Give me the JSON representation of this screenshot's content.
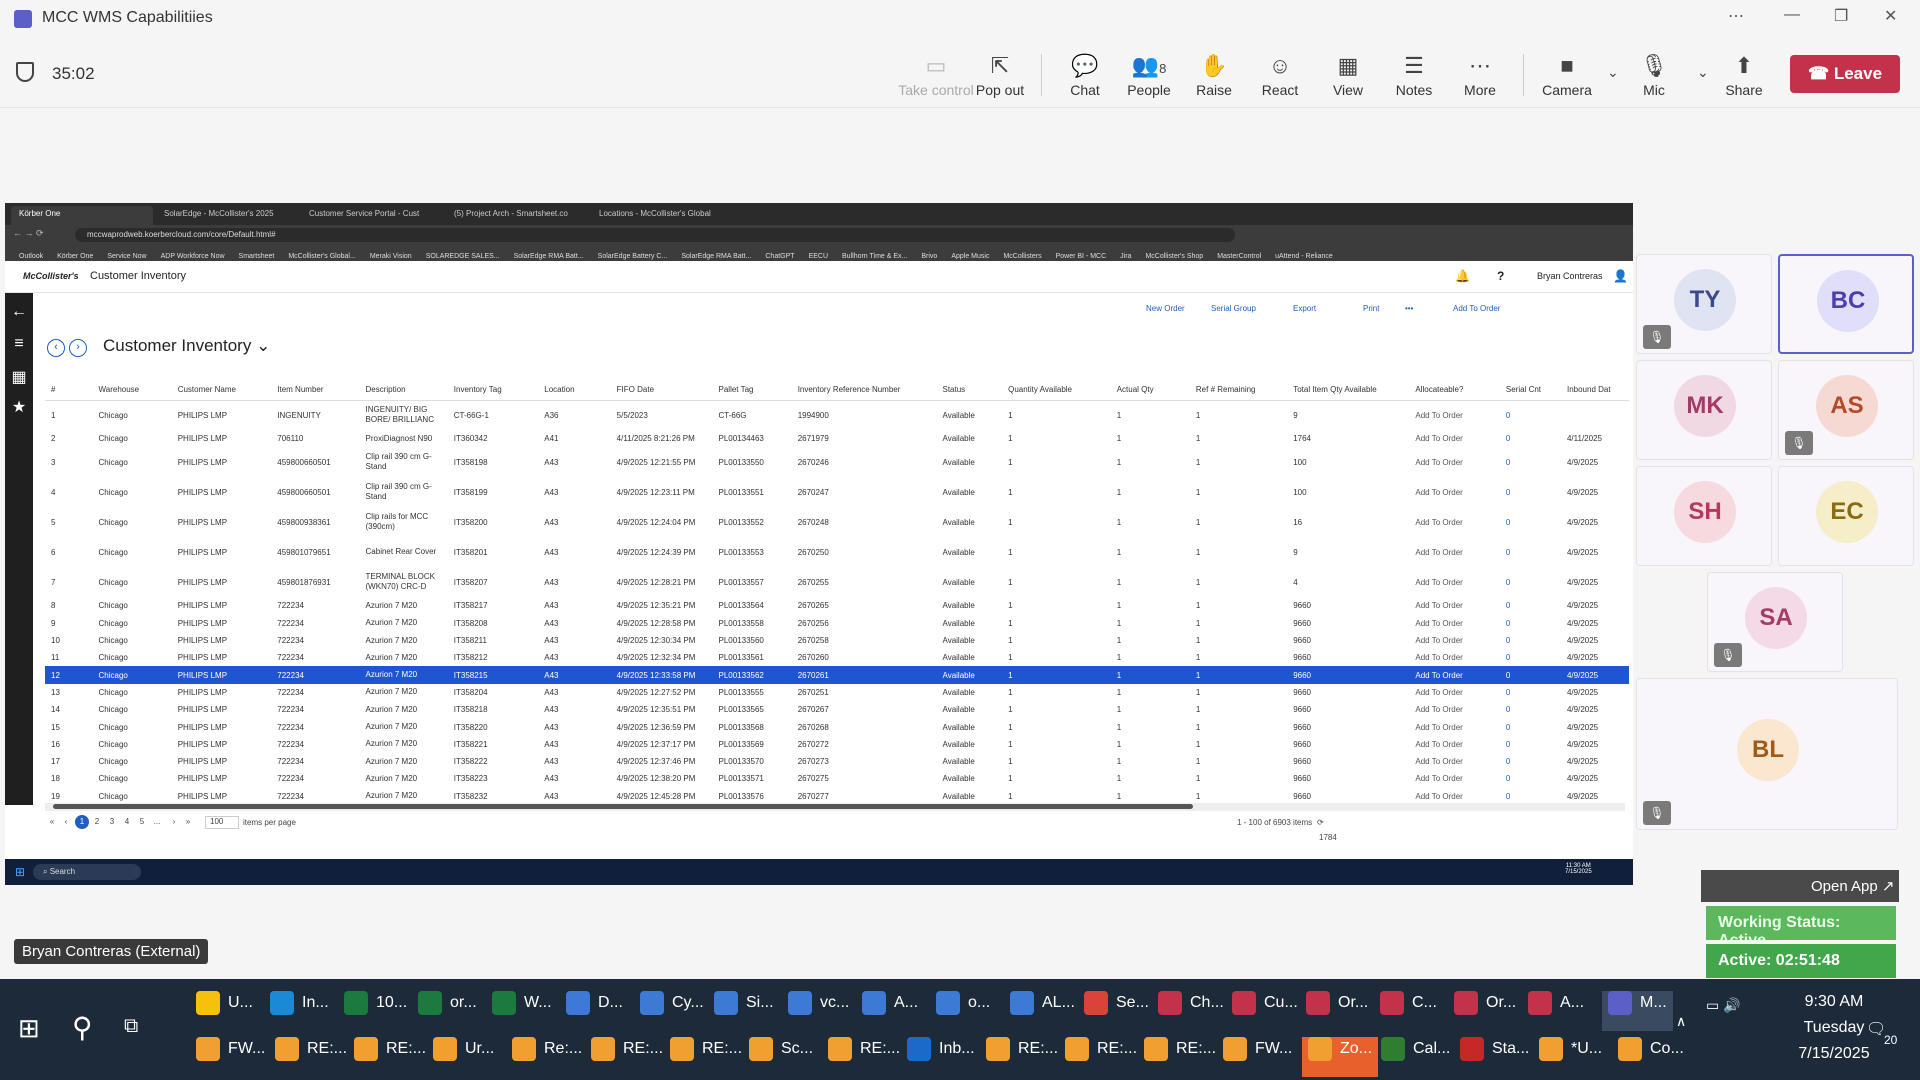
{
  "window": {
    "title": "MCC WMS Capabilitiies"
  },
  "meeting": {
    "timer": "35:02",
    "toolbar": [
      {
        "label": "Take control",
        "icon": "take-control-icon",
        "glyph": "▭",
        "disabled": true
      },
      {
        "label": "Pop out",
        "icon": "pop-out-icon",
        "glyph": "⇱"
      },
      {
        "label": "Chat",
        "icon": "chat-icon",
        "glyph": "💬"
      },
      {
        "label": "People",
        "icon": "people-icon",
        "glyph": "👥",
        "badge": "8"
      },
      {
        "label": "Raise",
        "icon": "raise-hand-icon",
        "glyph": "✋"
      },
      {
        "label": "React",
        "icon": "react-icon",
        "glyph": "☺"
      },
      {
        "label": "View",
        "icon": "view-icon",
        "glyph": "▦"
      },
      {
        "label": "Notes",
        "icon": "notes-icon",
        "glyph": "☰"
      },
      {
        "label": "More",
        "icon": "more-icon",
        "glyph": "⋯"
      },
      {
        "label": "Camera",
        "icon": "camera-off-icon",
        "glyph": "■"
      },
      {
        "label": "Mic",
        "icon": "mic-off-icon",
        "glyph": "🎙"
      },
      {
        "label": "Share",
        "icon": "share-icon",
        "glyph": "⬆"
      }
    ],
    "leave": "Leave",
    "presenter_label": "Bryan Contreras (External)",
    "participants": [
      {
        "initials": "TY",
        "muted": true,
        "bg": "#dfe3f2",
        "fg": "#3b4a88"
      },
      {
        "initials": "BC",
        "muted": false,
        "active": true,
        "bg": "#e1defa",
        "fg": "#4b3fb0"
      },
      {
        "initials": "MK",
        "muted": false,
        "bg": "#f0d9e3",
        "fg": "#a33a68"
      },
      {
        "initials": "AS",
        "muted": true,
        "bg": "#f7d9d3",
        "fg": "#b34a2a"
      },
      {
        "initials": "SH",
        "muted": false,
        "bg": "#f7d9e0",
        "fg": "#b53a5a"
      },
      {
        "initials": "EC",
        "muted": false,
        "bg": "#f6edc9",
        "fg": "#8a6b12"
      },
      {
        "initials": "SA",
        "muted": true,
        "bg": "#f3dae6",
        "fg": "#a33a68"
      },
      {
        "initials": "BL",
        "muted": true,
        "bg": "#fbe6cf",
        "fg": "#a05a1a"
      }
    ],
    "open_app": "Open App ↗",
    "working_status": "Working Status: Active",
    "active_time": "Active: 02:51:48"
  },
  "browser": {
    "tabs": [
      "Körber One",
      "SolarEdge - McCollister's 2025",
      "Customer Service Portal - Cust",
      "(5) Project Arch - Smartsheet.co",
      "Locations - McCollister's Global"
    ],
    "url": "mccwaprodweb.koerbercloud.com/core/Default.html#",
    "bookmarks": [
      "Outlook",
      "Körber One",
      "Service Now",
      "ADP Workforce Now",
      "Smartsheet",
      "McCollister's Global...",
      "Meraki Vision",
      "SOLAREDGE SALES...",
      "SolarEdge RMA Batt...",
      "SolarEdge Battery C...",
      "SolarEdge RMA Batt...",
      "ChatGPT",
      "EECU",
      "Bullhorn Time & Ex...",
      "Brivo",
      "Apple Music",
      "McCollisters",
      "Power BI - MCC",
      "Jira",
      "McCollister's Shop",
      "MasterControl",
      "uAttend - Reliance"
    ]
  },
  "app": {
    "logo": "McCollister's",
    "module": "Customer Inventory",
    "user": "Bryan Contreras",
    "page_title": "Customer Inventory",
    "actions": [
      "New Order",
      "Serial Group",
      "Export",
      "Print",
      "•••",
      "Add To Order"
    ],
    "columns": [
      "#",
      "Warehouse",
      "Customer Name",
      "Item Number",
      "Description",
      "Inventory Tag",
      "Location",
      "FIFO Date",
      "Pallet Tag",
      "Inventory Reference Number",
      "Status",
      "Quantity Available",
      "Actual Qty",
      "Ref # Remaining",
      "Total Item Qty Available",
      "Allocateable?",
      "Serial Cnt",
      "Inbound Dat"
    ],
    "rows": [
      [
        "1",
        "Chicago",
        "PHILIPS LMP",
        "INGENUITY",
        "INGENUITY/ BIG BORE/ BRILLIANC",
        "CT-66G-1",
        "A36",
        "5/5/2023",
        "CT-66G",
        "1994900",
        "Available",
        "1",
        "1",
        "1",
        "9",
        "Add To Order",
        "0",
        ""
      ],
      [
        "2",
        "Chicago",
        "PHILIPS LMP",
        "706110",
        "ProxiDiagnost N90",
        "IT360342",
        "A41",
        "4/11/2025 8:21:26 PM",
        "PL00134463",
        "2671979",
        "Available",
        "1",
        "1",
        "1",
        "1764",
        "Add To Order",
        "0",
        "4/11/2025"
      ],
      [
        "3",
        "Chicago",
        "PHILIPS LMP",
        "459800660501",
        "Clip rail 390 cm G-Stand",
        "IT358198",
        "A43",
        "4/9/2025 12:21:55 PM",
        "PL00133550",
        "2670246",
        "Available",
        "1",
        "1",
        "1",
        "100",
        "Add To Order",
        "0",
        "4/9/2025"
      ],
      [
        "4",
        "Chicago",
        "PHILIPS LMP",
        "459800660501",
        "Clip rail 390 cm G-Stand",
        "IT358199",
        "A43",
        "4/9/2025 12:23:11 PM",
        "PL00133551",
        "2670247",
        "Available",
        "1",
        "1",
        "1",
        "100",
        "Add To Order",
        "0",
        "4/9/2025"
      ],
      [
        "5",
        "Chicago",
        "PHILIPS LMP",
        "459800938361",
        "Clip rails for MCC (390cm)",
        "IT358200",
        "A43",
        "4/9/2025 12:24:04 PM",
        "PL00133552",
        "2670248",
        "Available",
        "1",
        "1",
        "1",
        "16",
        "Add To Order",
        "0",
        "4/9/2025"
      ],
      [
        "6",
        "Chicago",
        "PHILIPS LMP",
        "459801079651",
        "Cabinet Rear Cover",
        "IT358201",
        "A43",
        "4/9/2025 12:24:39 PM",
        "PL00133553",
        "2670250",
        "Available",
        "1",
        "1",
        "1",
        "9",
        "Add To Order",
        "0",
        "4/9/2025"
      ],
      [
        "7",
        "Chicago",
        "PHILIPS LMP",
        "459801876931",
        "TERMINAL BLOCK (WKN70) CRC-D",
        "IT358207",
        "A43",
        "4/9/2025 12:28:21 PM",
        "PL00133557",
        "2670255",
        "Available",
        "1",
        "1",
        "1",
        "4",
        "Add To Order",
        "0",
        "4/9/2025"
      ],
      [
        "8",
        "Chicago",
        "PHILIPS LMP",
        "722234",
        "Azurion 7 M20",
        "IT358217",
        "A43",
        "4/9/2025 12:35:21 PM",
        "PL00133564",
        "2670265",
        "Available",
        "1",
        "1",
        "1",
        "9660",
        "Add To Order",
        "0",
        "4/9/2025"
      ],
      [
        "9",
        "Chicago",
        "PHILIPS LMP",
        "722234",
        "Azurion 7 M20",
        "IT358208",
        "A43",
        "4/9/2025 12:28:58 PM",
        "PL00133558",
        "2670256",
        "Available",
        "1",
        "1",
        "1",
        "9660",
        "Add To Order",
        "0",
        "4/9/2025"
      ],
      [
        "10",
        "Chicago",
        "PHILIPS LMP",
        "722234",
        "Azurion 7 M20",
        "IT358211",
        "A43",
        "4/9/2025 12:30:34 PM",
        "PL00133560",
        "2670258",
        "Available",
        "1",
        "1",
        "1",
        "9660",
        "Add To Order",
        "0",
        "4/9/2025"
      ],
      [
        "11",
        "Chicago",
        "PHILIPS LMP",
        "722234",
        "Azurion 7 M20",
        "IT358212",
        "A43",
        "4/9/2025 12:32:34 PM",
        "PL00133561",
        "2670260",
        "Available",
        "1",
        "1",
        "1",
        "9660",
        "Add To Order",
        "0",
        "4/9/2025"
      ],
      [
        "12",
        "Chicago",
        "PHILIPS LMP",
        "722234",
        "Azurion 7 M20",
        "IT358215",
        "A43",
        "4/9/2025 12:33:58 PM",
        "PL00133562",
        "2670261",
        "Available",
        "1",
        "1",
        "1",
        "9660",
        "Add To Order",
        "0",
        "4/9/2025"
      ],
      [
        "13",
        "Chicago",
        "PHILIPS LMP",
        "722234",
        "Azurion 7 M20",
        "IT358204",
        "A43",
        "4/9/2025 12:27:52 PM",
        "PL00133555",
        "2670251",
        "Available",
        "1",
        "1",
        "1",
        "9660",
        "Add To Order",
        "0",
        "4/9/2025"
      ],
      [
        "14",
        "Chicago",
        "PHILIPS LMP",
        "722234",
        "Azurion 7 M20",
        "IT358218",
        "A43",
        "4/9/2025 12:35:51 PM",
        "PL00133565",
        "2670267",
        "Available",
        "1",
        "1",
        "1",
        "9660",
        "Add To Order",
        "0",
        "4/9/2025"
      ],
      [
        "15",
        "Chicago",
        "PHILIPS LMP",
        "722234",
        "Azurion 7 M20",
        "IT358220",
        "A43",
        "4/9/2025 12:36:59 PM",
        "PL00133568",
        "2670268",
        "Available",
        "1",
        "1",
        "1",
        "9660",
        "Add To Order",
        "0",
        "4/9/2025"
      ],
      [
        "16",
        "Chicago",
        "PHILIPS LMP",
        "722234",
        "Azurion 7 M20",
        "IT358221",
        "A43",
        "4/9/2025 12:37:17 PM",
        "PL00133569",
        "2670272",
        "Available",
        "1",
        "1",
        "1",
        "9660",
        "Add To Order",
        "0",
        "4/9/2025"
      ],
      [
        "17",
        "Chicago",
        "PHILIPS LMP",
        "722234",
        "Azurion 7 M20",
        "IT358222",
        "A43",
        "4/9/2025 12:37:46 PM",
        "PL00133570",
        "2670273",
        "Available",
        "1",
        "1",
        "1",
        "9660",
        "Add To Order",
        "0",
        "4/9/2025"
      ],
      [
        "18",
        "Chicago",
        "PHILIPS LMP",
        "722234",
        "Azurion 7 M20",
        "IT358223",
        "A43",
        "4/9/2025 12:38:20 PM",
        "PL00133571",
        "2670275",
        "Available",
        "1",
        "1",
        "1",
        "9660",
        "Add To Order",
        "0",
        "4/9/2025"
      ],
      [
        "19",
        "Chicago",
        "PHILIPS LMP",
        "722234",
        "Azurion 7 M20",
        "IT358232",
        "A43",
        "4/9/2025 12:45:28 PM",
        "PL00133576",
        "2670277",
        "Available",
        "1",
        "1",
        "1",
        "9660",
        "Add To Order",
        "0",
        "4/9/2025"
      ]
    ],
    "selected_row": 12,
    "pager": {
      "pages": [
        "1",
        "2",
        "3",
        "4",
        "5",
        "..."
      ],
      "per_page": "100",
      "per_page_label": "items per page",
      "summary": "1 - 100 of 6903 items",
      "total": "1784"
    }
  },
  "taskbar": {
    "row1": [
      "U...",
      "In...",
      "10...",
      "or...",
      "W...",
      "D...",
      "Cy...",
      "Si...",
      "vc...",
      "A...",
      "o...",
      "AL...",
      "Se...",
      "Ch...",
      "Cu...",
      "Or...",
      "C...",
      "Or...",
      "A...",
      "M..."
    ],
    "row2": [
      "FW...",
      "RE:...",
      "RE:...",
      "Ur...",
      "Re:...",
      "RE:...",
      "RE:...",
      "Sc...",
      "RE:...",
      "Inb...",
      "RE:...",
      "RE:...",
      "RE:...",
      "FW...",
      "Zo...",
      "Cal...",
      "Sta...",
      "*U...",
      "Co..."
    ],
    "time": "9:30 AM",
    "day": "Tuesday",
    "date": "7/15/2025",
    "notifications": "20"
  }
}
